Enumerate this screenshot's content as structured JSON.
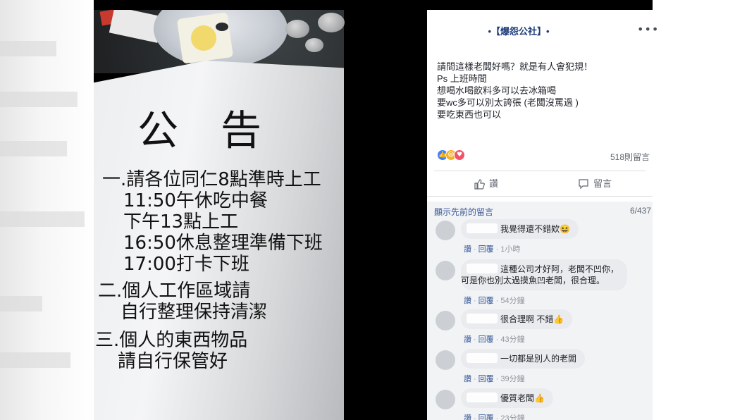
{
  "post": {
    "page_name": "•【爆怨公社】•",
    "more_icon": "•••",
    "text_lines": [
      "請問這樣老闆好嗎？就是有人會犯規！",
      "Ps 上班時間",
      "想喝水喝飲料多可以去冰箱喝",
      "要wc多可以別太誇張 (老闆沒罵過 )",
      "要吃東西也可以"
    ],
    "comment_count": "518則留言",
    "like_label": "讚",
    "comment_label": "留言",
    "reaction_colors": {
      "like": "#4080ff",
      "haha": "#f7b125",
      "love": "#f25268"
    }
  },
  "photo": {
    "notice_title": "公告",
    "notice_lines": [
      "一.請各位同仁8點準時上工",
      "11:50午休吃中餐",
      "下午13點上工",
      "16:50休息整理準備下班",
      "17:00打卡下班",
      "二.個人工作區域請",
      "自行整理保持清潔",
      "三.個人的東西物品",
      "請自行保管好"
    ]
  },
  "comments_section": {
    "view_previous": "顯示先前的留言",
    "count": "6/437",
    "like": "讚",
    "reply": "回覆",
    "items": [
      {
        "text": [
          "我覺得還不錯欸😆"
        ],
        "time": "1小時"
      },
      {
        "text": [
          "這種公司才好阿，老闆不凹你，",
          "可是你也別太過摸魚凹老闆，很合理。"
        ],
        "time": "54分鐘"
      },
      {
        "text": [
          "很合理啊 不錯👍"
        ],
        "time": "43分鐘"
      },
      {
        "text": [
          "一切都是別人的老闆"
        ],
        "time": "39分鐘"
      },
      {
        "text": [
          "優質老闆👍"
        ],
        "time": "23分鐘"
      }
    ]
  }
}
